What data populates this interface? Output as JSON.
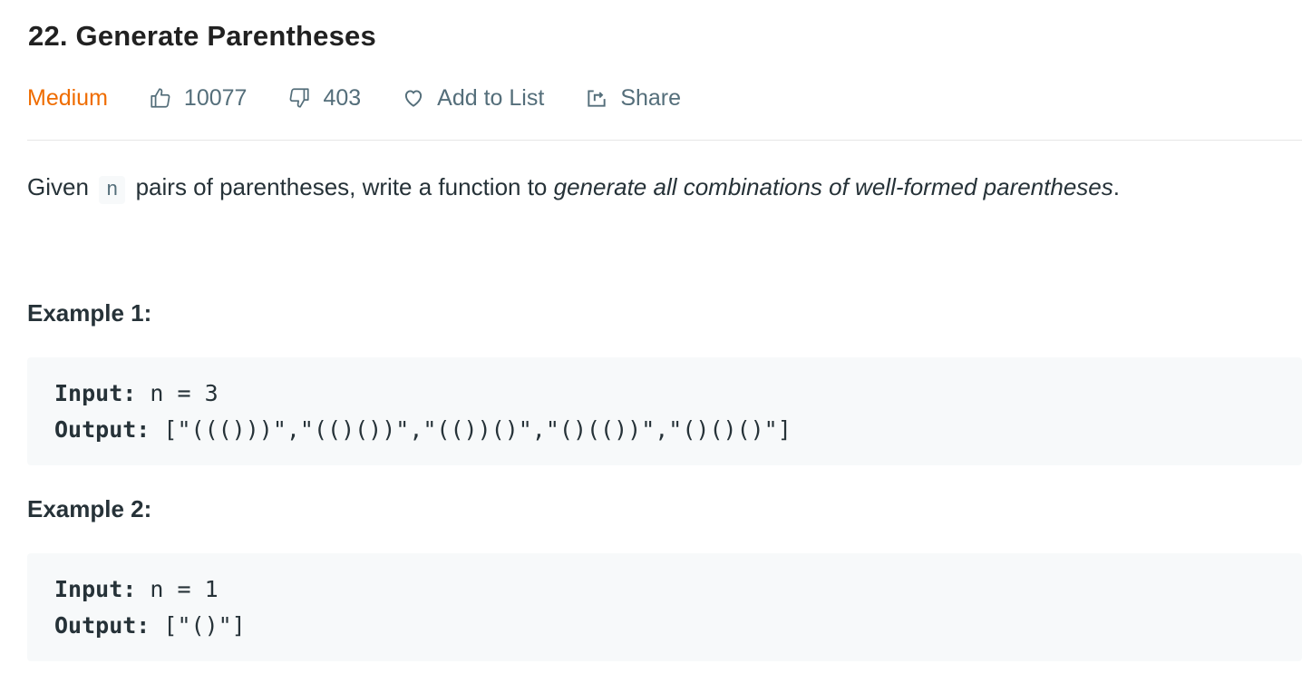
{
  "problem": {
    "title": "22. Generate Parentheses",
    "difficulty": "Medium",
    "likes": "10077",
    "dislikes": "403",
    "add_to_list_label": "Add to List",
    "share_label": "Share",
    "description": {
      "before_code": "Given ",
      "code": "n",
      "middle": " pairs of parentheses, write a function to ",
      "emphasis": "generate all combinations of well-formed parentheses",
      "end": "."
    }
  },
  "examples": [
    {
      "title": "Example 1:",
      "input_label": "Input:",
      "input_value": " n = 3",
      "output_label": "Output:",
      "output_value": " [\"((()))\",\"(()())\",\"(())()\",\"()(())\",\"()()()\"]"
    },
    {
      "title": "Example 2:",
      "input_label": "Input:",
      "input_value": " n = 1",
      "output_label": "Output:",
      "output_value": " [\"()\"]"
    }
  ],
  "colors": {
    "difficulty_medium": "#ef6c00",
    "meta_text": "#546e7a",
    "code_background": "#f7f9fa"
  },
  "icons": {
    "likes": "thumbs-up-icon",
    "dislikes": "thumbs-down-icon",
    "add_to_list": "heart-icon",
    "share": "share-icon"
  }
}
